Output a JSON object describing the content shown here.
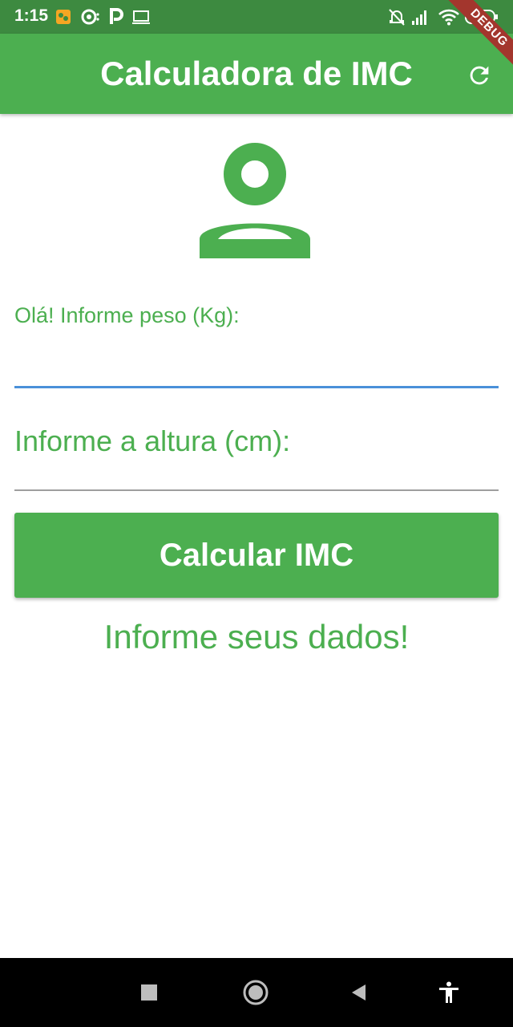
{
  "status_bar": {
    "time": "1:15",
    "battery": "53",
    "icons": [
      "notification-app-icon",
      "sync-icon",
      "p-app-icon",
      "laptop-icon",
      "bell-off-icon",
      "signal-icon",
      "wifi-icon",
      "battery-icon"
    ]
  },
  "debug_banner": "DEBUG",
  "app_bar": {
    "title": "Calculadora de IMC",
    "refresh_icon": "refresh-icon"
  },
  "form": {
    "weight_label": "Olá! Informe peso (Kg):",
    "weight_value": "",
    "height_placeholder": "Informe a altura (cm):",
    "height_value": "",
    "calculate_button": "Calcular IMC"
  },
  "result": {
    "info_text": "Informe seus dados!"
  },
  "nav_bar": {
    "icons": [
      "recents-icon",
      "home-icon",
      "back-icon",
      "accessibility-icon"
    ]
  },
  "colors": {
    "primary": "#4caf50",
    "status_bar": "#3d8a40",
    "focus_underline": "#4a90d9",
    "debug": "#a3362d"
  }
}
